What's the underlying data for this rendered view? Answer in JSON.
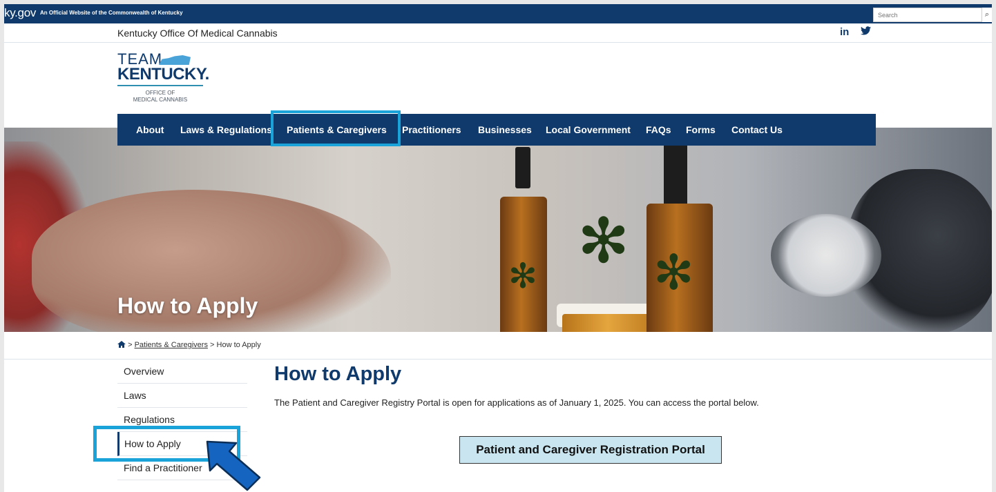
{
  "topbar": {
    "logo": "ky.gov",
    "official_text": "An Official Website of the Commonwealth of Kentucky",
    "search_placeholder": "Search",
    "search_icon": "search-icon"
  },
  "sitebar": {
    "office_name": "Kentucky Office Of Medical Cannabis",
    "linkedin": "in",
    "twitter": "twitter-icon"
  },
  "brand": {
    "team": "TEAM",
    "kentucky": "KENTUCKY.",
    "office_line1": "OFFICE OF",
    "office_line2": "MEDICAL CANNABIS"
  },
  "nav": {
    "items": [
      "About",
      "Laws & Regulations",
      "Patients & Caregivers",
      "Practitioners",
      "Businesses",
      "Local Government",
      "FAQs",
      "Forms",
      "Contact Us"
    ],
    "highlighted": "Patients & Caregivers",
    "highlight_color": "#1aa3d8"
  },
  "hero": {
    "title": "How to Apply"
  },
  "breadcrumb": {
    "home_icon": "home-icon",
    "sep": ">",
    "parent": "Patients & Caregivers",
    "current": "How to Apply"
  },
  "sidenav": {
    "items": [
      "Overview",
      "Laws",
      "Regulations",
      "How to Apply",
      "Find a Practitioner"
    ],
    "active": "How to Apply"
  },
  "main": {
    "title": "How to Apply",
    "intro": "The Patient and Caregiver Registry Portal is open for applications as of January 1, 2025. You can access the portal below.",
    "portal_button": "Patient and Caregiver Registration Portal"
  },
  "colors": {
    "primary_navy": "#0f3a6b",
    "highlight_blue": "#1aa3d8",
    "portal_bg": "#c9e6f0"
  }
}
